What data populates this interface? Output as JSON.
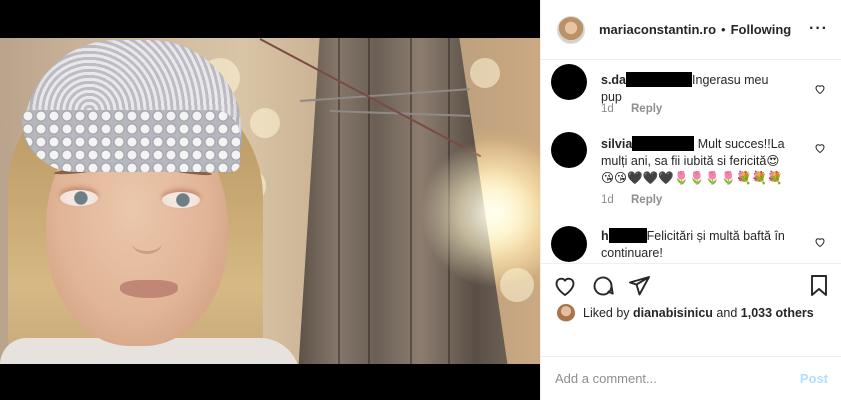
{
  "header": {
    "username": "mariaconstantin.ro",
    "separator": "•",
    "follow_status": "Following",
    "more_label": "···"
  },
  "comments": [
    {
      "user": "s.da",
      "text": "Ingerasu meu pup",
      "age": "1d",
      "reply_label": "Reply"
    },
    {
      "user": "silvia",
      "text_line1": "Mult succes!!La",
      "text_line2": "mulți ani, sa fii iubită si fericită😍",
      "text_line3": "😘😘🖤🖤🖤🌷🌷🌷🌷💐💐💐",
      "age": "1d",
      "reply_label": "Reply"
    },
    {
      "user": "h",
      "text_line1": "Felicitări și multă baftă în",
      "text_line2": "continuare!"
    }
  ],
  "likes": {
    "prefix": "Liked by",
    "user": "dianabisinicu",
    "middle": "and",
    "count": "1,033 others"
  },
  "add_comment": {
    "placeholder": "Add a comment...",
    "post_label": "Post"
  },
  "icons": [
    "heart-icon",
    "comment-icon",
    "share-icon",
    "bookmark-icon",
    "comment-like-heart-icon"
  ],
  "colors": {
    "post_button": "#b2dffc",
    "meta_text": "#8e8e8e",
    "text": "#262626"
  }
}
